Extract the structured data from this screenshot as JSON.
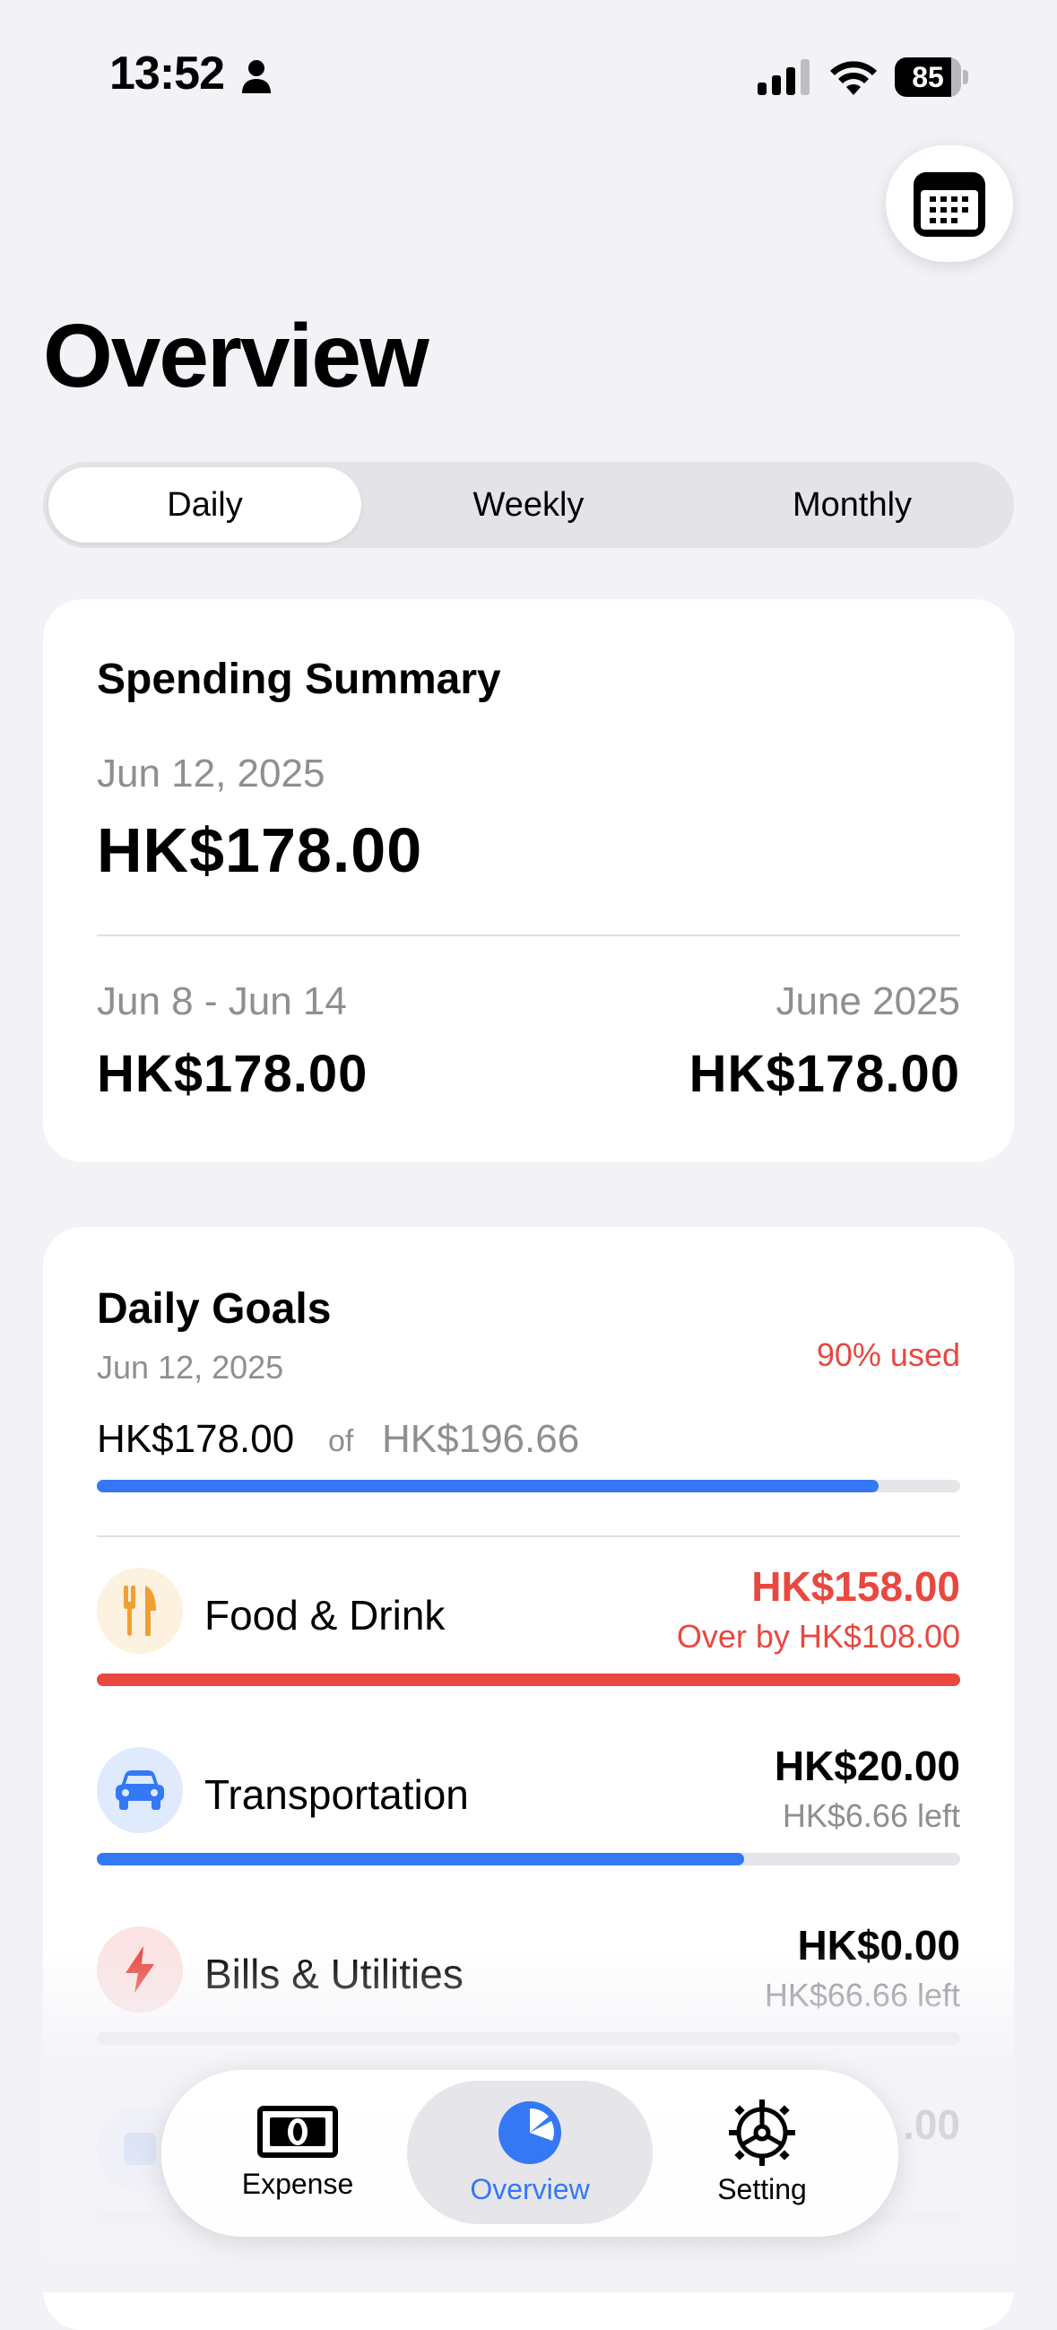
{
  "status_bar": {
    "time": "13:52",
    "battery": "85",
    "battery_level": 0.85
  },
  "header": {
    "title": "Overview",
    "calendar_icon": "calendar-icon"
  },
  "segments": {
    "items": [
      "Daily",
      "Weekly",
      "Monthly"
    ],
    "selected": "Daily"
  },
  "summary": {
    "title": "Spending Summary",
    "day_label": "Jun 12, 2025",
    "day_amount": "HK$178.00",
    "week_label": "Jun 8 - Jun 14",
    "week_amount": "HK$178.00",
    "month_label": "June 2025",
    "month_amount": "HK$178.00"
  },
  "goals": {
    "title": "Daily Goals",
    "date": "Jun 12, 2025",
    "used_text": "90% used",
    "spent": "HK$178.00",
    "of": "of",
    "budget": "HK$196.66",
    "progress": 0.905,
    "categories": [
      {
        "name": "Food & Drink",
        "amount": "HK$158.00",
        "sub": "Over by HK$108.00",
        "progress": 1.0,
        "icon": "fork-knife-icon",
        "color": "#e8483f",
        "icon_bg": "#fdf1df",
        "icon_color": "#f0a030",
        "amount_color": "#e8483f",
        "sub_color": "#e8483f"
      },
      {
        "name": "Transportation",
        "amount": "HK$20.00",
        "sub": "HK$6.66 left",
        "progress": 0.75,
        "icon": "car-icon",
        "color": "#3478f6",
        "icon_bg": "#dfeafc",
        "icon_color": "#3478f6",
        "amount_color": "#000000",
        "sub_color": "#8e8e93"
      },
      {
        "name": "Bills & Utilities",
        "amount": "HK$0.00",
        "sub": "HK$66.66 left",
        "progress": 0.0,
        "icon": "bolt-icon",
        "color": "#3478f6",
        "icon_bg": "#fbe3e3",
        "icon_color": "#e8483f",
        "amount_color": "#000000",
        "sub_color": "#8e8e93"
      },
      {
        "name": "",
        "amount": ".00",
        "sub": "",
        "progress": 0.0,
        "icon": "category-icon",
        "color": "#3478f6",
        "icon_bg": "#dfeafc",
        "icon_color": "#3478f6",
        "amount_color": "#000000",
        "sub_color": "#8e8e93"
      }
    ]
  },
  "tabbar": {
    "items": [
      {
        "label": "Expense",
        "icon": "banknote-icon"
      },
      {
        "label": "Overview",
        "icon": "pie-chart-icon"
      },
      {
        "label": "Setting",
        "icon": "gear-icon"
      }
    ],
    "selected": "Overview"
  }
}
